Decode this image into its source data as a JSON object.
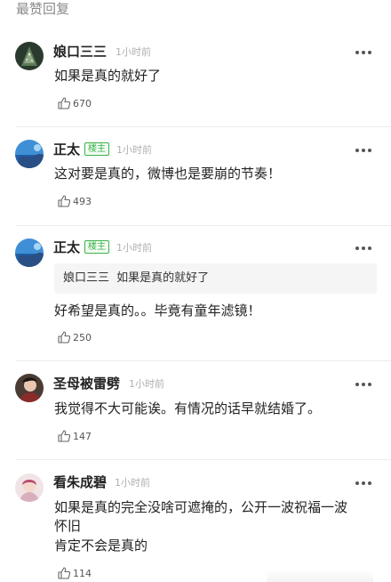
{
  "section_title": "最赞回复",
  "comments": [
    {
      "user": "娘口三三",
      "badge": "",
      "time": "1小时前",
      "quote_user": "",
      "quote_text": "",
      "text": "如果是真的就好了",
      "likes": "670",
      "avatar": "avatar-dark-tree"
    },
    {
      "user": "正太",
      "badge": "楼主",
      "time": "1小时前",
      "quote_user": "",
      "quote_text": "",
      "text": "这对要是真的，微博也是要崩的节奏！",
      "likes": "493",
      "avatar": "avatar-blue-sea"
    },
    {
      "user": "正太",
      "badge": "楼主",
      "time": "1小时前",
      "quote_user": "娘口三三",
      "quote_text": "如果是真的就好了",
      "text": "好希望是真的。。毕竟有童年滤镜！",
      "likes": "250",
      "avatar": "avatar-blue-sea"
    },
    {
      "user": "圣母被雷劈",
      "badge": "",
      "time": "1小时前",
      "quote_user": "",
      "quote_text": "",
      "text": "我觉得不大可能诶。有情况的话早就结婚了。",
      "likes": "147",
      "avatar": "avatar-person-dark"
    },
    {
      "user": "看朱成碧",
      "badge": "",
      "time": "1小时前",
      "quote_user": "",
      "quote_text": "",
      "text_line1": "如果是真的完全没啥可遮掩的，公开一波祝福一波",
      "text_line2": "怀旧",
      "text_line3": "肯定不会是真的",
      "likes": "114",
      "avatar": "avatar-person-light"
    }
  ],
  "colors": {
    "badge_green": "#3bb34a",
    "muted": "#b0b0b0",
    "divider": "#ececec"
  },
  "icons": [
    "more-icon",
    "like-icon"
  ]
}
